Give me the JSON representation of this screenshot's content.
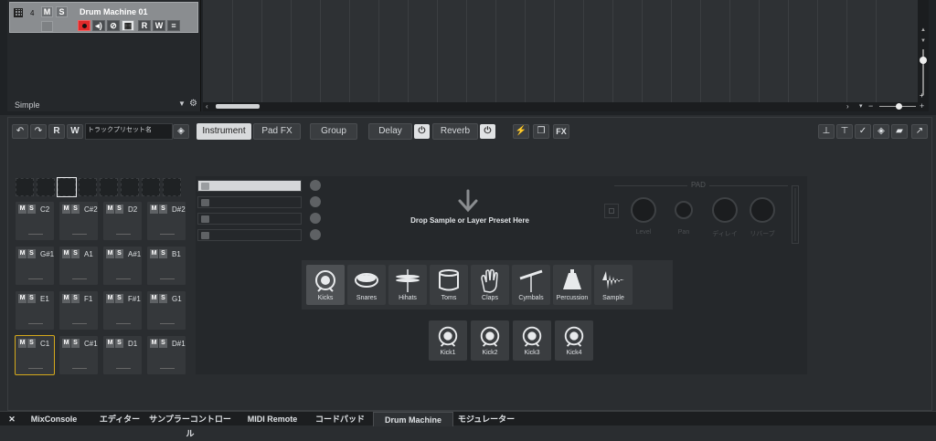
{
  "track": {
    "number": "4",
    "mute": "M",
    "solo": "S",
    "name": "Drum Machine 01",
    "read": "R",
    "write": "W",
    "preset": "Simple"
  },
  "toolbar": {
    "read": "R",
    "write": "W",
    "preset_name": "トラックプリセット名",
    "tabs": [
      "Instrument",
      "Pad FX",
      "Group",
      "Delay",
      "Reverb"
    ],
    "fx_label": "FX"
  },
  "pads": [
    {
      "note": "C2"
    },
    {
      "note": "C#2"
    },
    {
      "note": "D2"
    },
    {
      "note": "D#2"
    },
    {
      "note": "G#1"
    },
    {
      "note": "A1"
    },
    {
      "note": "A#1"
    },
    {
      "note": "B1"
    },
    {
      "note": "E1"
    },
    {
      "note": "F1"
    },
    {
      "note": "F#1"
    },
    {
      "note": "G1"
    },
    {
      "note": "C1"
    },
    {
      "note": "C#1"
    },
    {
      "note": "D1"
    },
    {
      "note": "D#1"
    }
  ],
  "pad_buttons": {
    "mute": "M",
    "solo": "S"
  },
  "selected_pad": "C1",
  "drop_text": "Drop Sample or Layer Preset Here",
  "pad_section": {
    "title": "PAD",
    "knobs": [
      "Level",
      "Pan",
      "ディレイ",
      "リバーブ"
    ]
  },
  "categories": [
    "Kicks",
    "Snares",
    "Hihats",
    "Toms",
    "Claps",
    "Cymbals",
    "Percussion",
    "Sample"
  ],
  "selected_category": "Kicks",
  "kicks": [
    "Kick1",
    "Kick2",
    "Kick3",
    "Kick4"
  ],
  "footer": {
    "close": "✕",
    "tabs": [
      "MixConsole",
      "エディター",
      "サンプラーコントロール",
      "MIDI Remote",
      "コードパッド",
      "Drum Machine",
      "モジュレーター"
    ],
    "active": "Drum Machine"
  },
  "colors": {
    "accent_selected": "#d5a91c",
    "record": "#e02a2a"
  }
}
